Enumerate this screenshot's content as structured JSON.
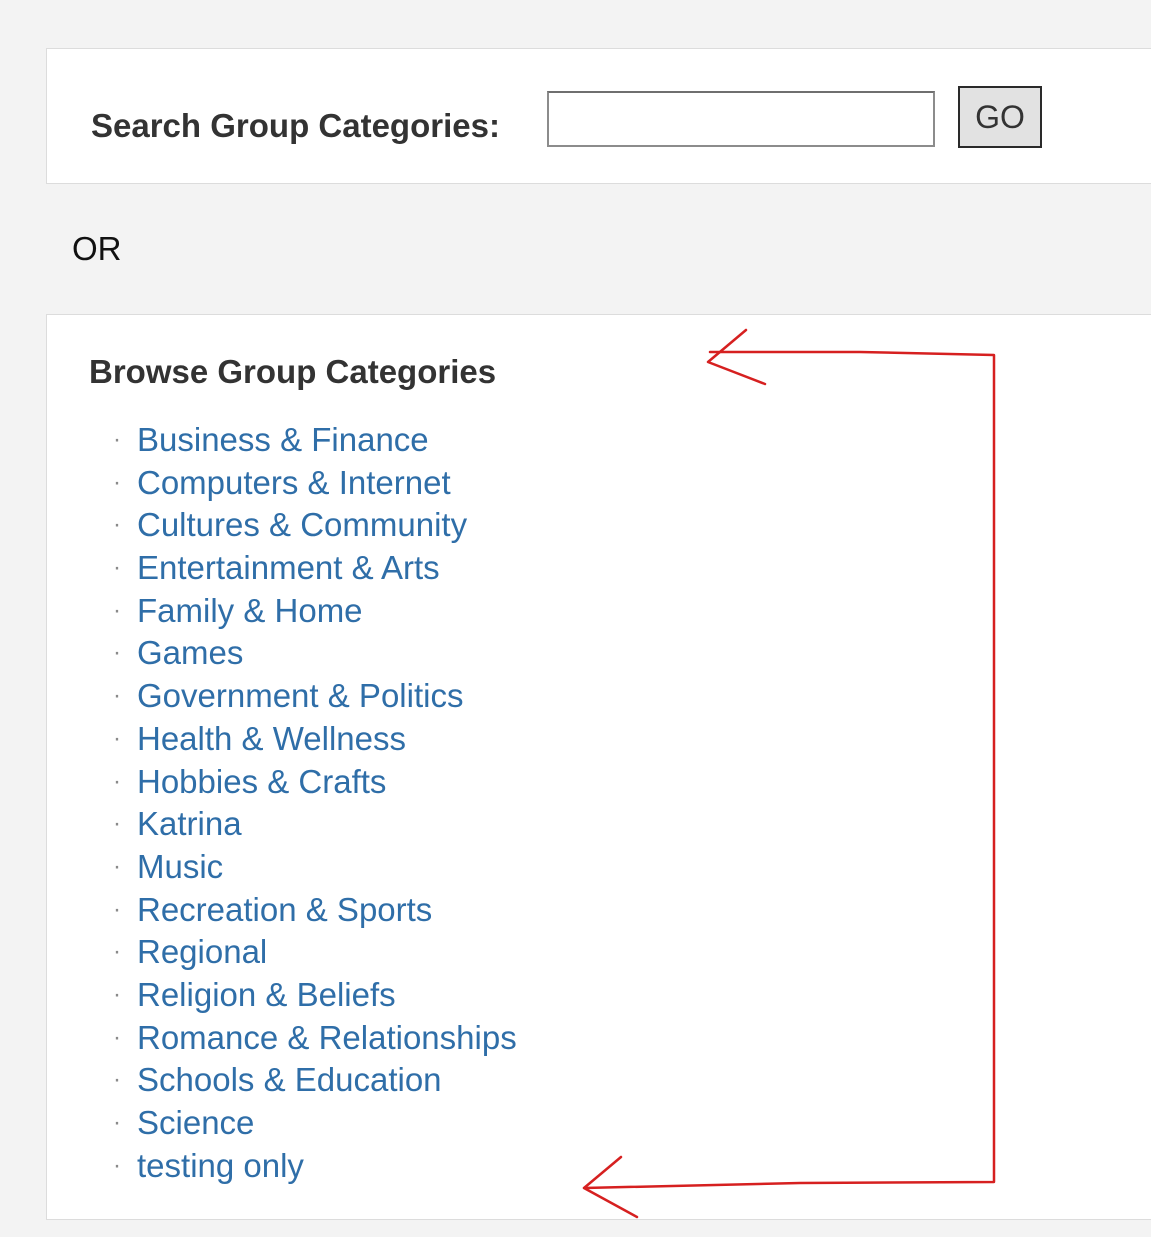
{
  "search": {
    "label": "Search Group Categories:",
    "input_value": "",
    "go_label": "GO"
  },
  "separator": {
    "or_text": "OR"
  },
  "browse": {
    "title": "Browse Group Categories",
    "bullet": "·",
    "categories": [
      "Business & Finance",
      "Computers & Internet",
      "Cultures & Community",
      "Entertainment & Arts",
      "Family & Home",
      "Games",
      "Government & Politics",
      "Health & Wellness",
      "Hobbies & Crafts",
      "Katrina",
      "Music",
      "Recreation & Sports",
      "Regional",
      "Religion & Beliefs",
      "Romance & Relationships",
      "Schools & Education",
      "Science",
      "testing only"
    ]
  },
  "colors": {
    "link": "#2f6ea8",
    "annotation_arrow": "#d62020",
    "page_background": "#f3f3f3"
  }
}
